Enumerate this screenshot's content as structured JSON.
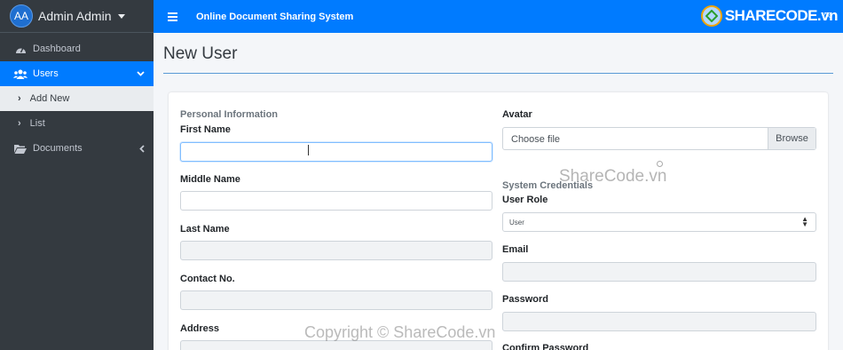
{
  "sidebar": {
    "avatar_initials": "AA",
    "user_name": "Admin Admin",
    "items": [
      {
        "label": "Dashboard",
        "icon": "dashboard-icon"
      },
      {
        "label": "Users",
        "icon": "users-icon"
      },
      {
        "label": "Add New",
        "icon": "chevron-right-icon"
      },
      {
        "label": "List",
        "icon": "chevron-right-icon"
      },
      {
        "label": "Documents",
        "icon": "folder-icon"
      }
    ]
  },
  "topbar": {
    "title": "Online Document Sharing System",
    "menu_icon": "hamburger-icon",
    "expand_icon": "expand-icon"
  },
  "page": {
    "title": "New User"
  },
  "form": {
    "personal_section": "Personal Information",
    "first_name_label": "First Name",
    "middle_name_label": "Middle Name",
    "last_name_label": "Last Name",
    "contact_label": "Contact No.",
    "address_label": "Address",
    "avatar_label": "Avatar",
    "file_placeholder": "Choose file",
    "browse_label": "Browse",
    "credentials_section": "System Credentials",
    "role_label": "User Role",
    "role_value": "User",
    "email_label": "Email",
    "password_label": "Password",
    "confirm_label": "Confirm Password"
  },
  "watermarks": {
    "logo_text": "SHARECODE.vn",
    "center_text": "ShareCode.vn",
    "copyright_text": "Copyright © ShareCode.vn"
  },
  "colors": {
    "primary": "#007bff",
    "sidebar": "#343a40"
  }
}
